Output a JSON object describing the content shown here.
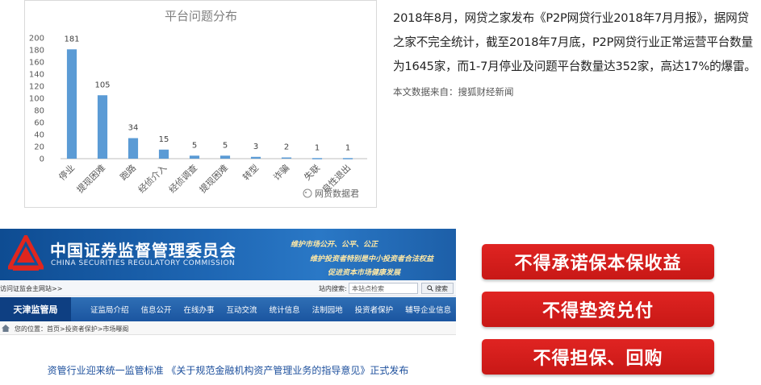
{
  "chart_data": {
    "type": "bar",
    "title": "平台问题分布",
    "categories": [
      "停业",
      "提现困难",
      "跑路",
      "经侦介入",
      "经侦调查",
      "提现困难",
      "转型",
      "诈骗",
      "失联",
      "良性退出"
    ],
    "values": [
      181,
      105,
      34,
      15,
      5,
      5,
      3,
      2,
      1,
      1
    ],
    "ylim": [
      0,
      200
    ],
    "yticks": [
      0,
      20,
      40,
      60,
      80,
      100,
      120,
      140,
      160,
      180,
      200
    ],
    "data_labels": true,
    "grid": false,
    "legend": "none",
    "bar_color": "#5b9bd5",
    "xlabel": "",
    "ylabel": ""
  },
  "chart_watermark": "网贷数据君",
  "article": {
    "paragraph": "2018年8月，网贷之家发布《P2P网贷行业2018年7月月报》，据网贷之家不完全统计，截至2018年7月底，P2P网贷行业正常运营平台数量为1645家，而1-7月停业及问题平台数量达352家，高达17%的爆雷。",
    "source": "本文数据来自：搜狐财经新闻"
  },
  "csrc_site": {
    "name_cn": "中国证券监督管理委员会",
    "name_en": "CHINA SECURITIES REGULATORY COMMISSION",
    "slogans": [
      "维护市场公开、公平、公正",
      "维护投资者特别是中小投资者合法权益",
      "促进资本市场健康发展"
    ],
    "util_left": "访问证监会主网站>>",
    "search_label": "站内搜索:",
    "search_placeholder": "本站点检索",
    "search_button": "搜索",
    "bureau": "天津监管局",
    "nav_items": [
      "证监局介绍",
      "信息公开",
      "在线办事",
      "互动交流",
      "统计信息",
      "法制园地",
      "投资者保护",
      "辅导企业信息"
    ],
    "breadcrumb": "您的位置：首页>投资者保护>市场曝阁",
    "headline": "资管行业迎来统一监管标准 《关于规范金融机构资产管理业务的指导意见》正式发布"
  },
  "red_banners": [
    "不得承诺保本保收益",
    "不得垫资兑付",
    "不得担保、回购"
  ],
  "colors": {
    "bar": "#5b9bd5",
    "csrc_blue": "#1b55a0",
    "banner_red": "#d81e1c"
  }
}
